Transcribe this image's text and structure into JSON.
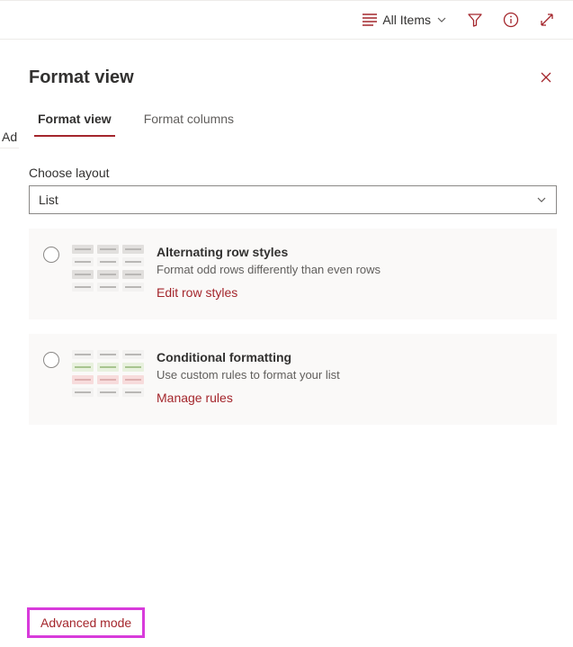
{
  "topbar": {
    "view_label": "All Items"
  },
  "left_fragment": "Ad",
  "panel": {
    "title": "Format view",
    "tabs": [
      {
        "label": "Format view",
        "active": true
      },
      {
        "label": "Format columns",
        "active": false
      }
    ],
    "choose_layout_label": "Choose layout",
    "layout_value": "List",
    "options": [
      {
        "title": "Alternating row styles",
        "desc": "Format odd rows differently than even rows",
        "link": "Edit row styles"
      },
      {
        "title": "Conditional formatting",
        "desc": "Use custom rules to format your list",
        "link": "Manage rules"
      }
    ],
    "advanced_label": "Advanced mode"
  }
}
